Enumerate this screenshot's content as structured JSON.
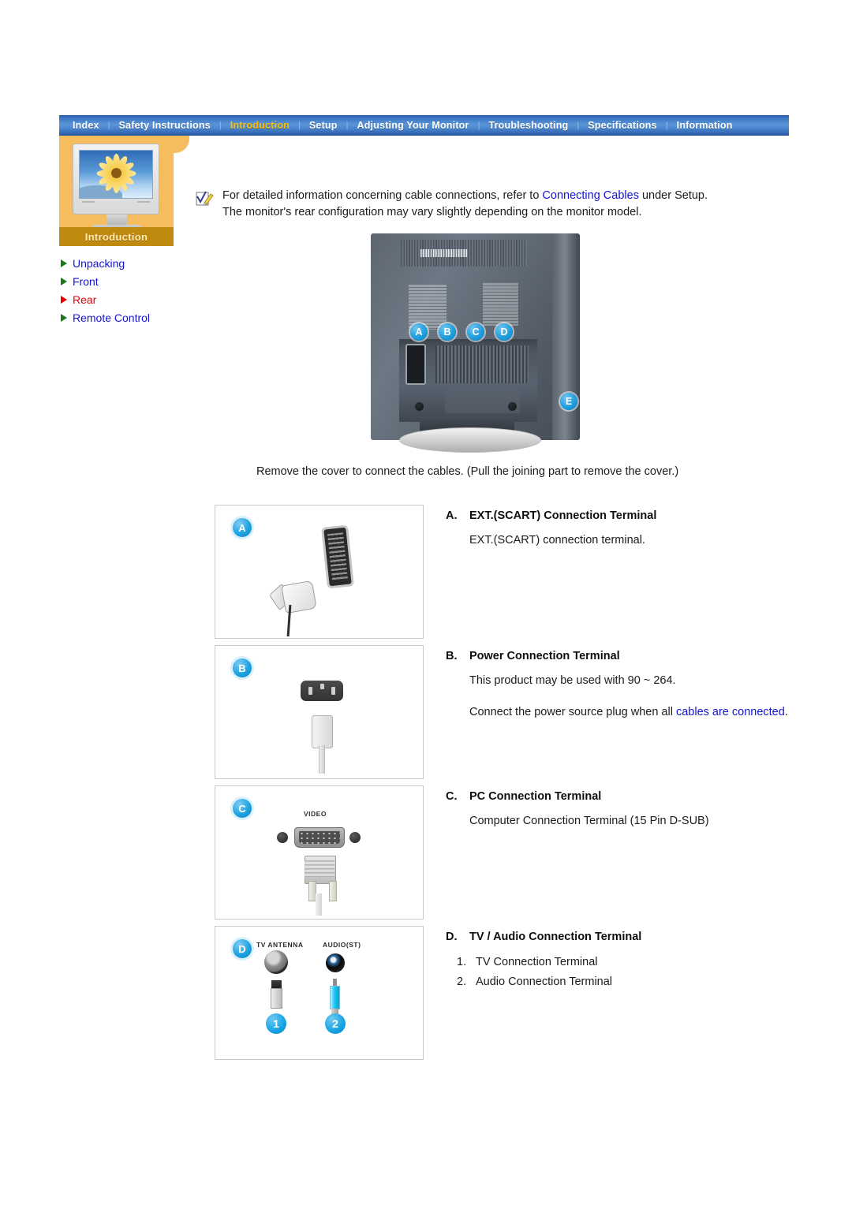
{
  "nav": {
    "items": [
      {
        "label": "Index",
        "active": false
      },
      {
        "label": "Safety Instructions",
        "active": false
      },
      {
        "label": "Introduction",
        "active": true
      },
      {
        "label": "Setup",
        "active": false
      },
      {
        "label": "Adjusting Your Monitor",
        "active": false
      },
      {
        "label": "Troubleshooting",
        "active": false
      },
      {
        "label": "Specifications",
        "active": false
      },
      {
        "label": "Information",
        "active": false
      }
    ],
    "separator": "|"
  },
  "sidebar": {
    "card_label": "Introduction",
    "links": [
      {
        "label": "Unpacking",
        "current": false
      },
      {
        "label": "Front",
        "current": false
      },
      {
        "label": "Rear",
        "current": true
      },
      {
        "label": "Remote Control",
        "current": false
      }
    ]
  },
  "note": {
    "line1_before": "For detailed information concerning cable connections, refer to ",
    "line1_link": "Connecting Cables",
    "line1_after": " under Setup.",
    "line2": "The monitor's rear configuration may vary slightly depending on the monitor model."
  },
  "rear_photo": {
    "badges": [
      "A",
      "B",
      "C",
      "D",
      "E"
    ],
    "caption": "Remove the cover to connect the cables. (Pull the joining part to remove the cover.)"
  },
  "sections": [
    {
      "badge": "A",
      "letter": "A.",
      "title": "EXT.(SCART) Connection Terminal",
      "body": "EXT.(SCART) connection terminal.",
      "pic_labels": []
    },
    {
      "badge": "B",
      "letter": "B.",
      "title": "Power Connection Terminal",
      "body": "This product may be used with 90 ~ 264.",
      "body2_before": "Connect the power source plug when all ",
      "body2_link": "cables are connected",
      "body2_after": ".",
      "pic_labels": []
    },
    {
      "badge": "C",
      "letter": "C.",
      "title": "PC Connection Terminal",
      "body": "Computer Connection Terminal (15 Pin D-SUB)",
      "pic_labels": [
        "VIDEO"
      ]
    },
    {
      "badge": "D",
      "letter": "D.",
      "title": "TV / Audio Connection Terminal",
      "list": [
        {
          "num": "1.",
          "label": "TV Connection Terminal"
        },
        {
          "num": "2.",
          "label": "Audio Connection Terminal"
        }
      ],
      "pic_labels": [
        "TV ANTENNA",
        "AUDIO(ST)"
      ],
      "pic_nums": [
        "1",
        "2"
      ]
    }
  ],
  "colors": {
    "nav_blue": "#3f78c4",
    "nav_active": "#ffc000",
    "sidebar_orange": "#f5bd5e",
    "sidebar_label_brown": "#c08a10",
    "link_blue": "#1414d2",
    "current_red": "#e60000",
    "badge_blue": "#1ba1e0"
  }
}
